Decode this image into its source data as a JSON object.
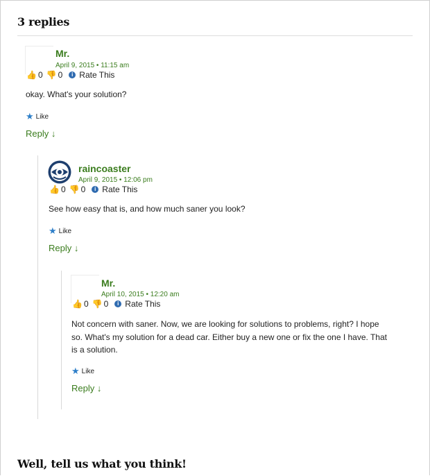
{
  "comments_heading": "3 replies",
  "footer_heading": "Well, tell us what you think!",
  "icons": {
    "thumb_up": "thumb-up-icon",
    "thumb_down": "thumb-down-icon",
    "info": "info-icon",
    "star": "star-icon",
    "avatar_logo": "raincoaster-logo-icon"
  },
  "colors": {
    "link_green": "#3a7c1d",
    "info_blue": "#2f6bb0",
    "star_blue": "#2e7fc9"
  },
  "comments": [
    {
      "author": "Mr.",
      "date": "April 9, 2015 • 11:15 am",
      "thumbs_up": "0",
      "thumbs_down": "0",
      "rate_label": "Rate This",
      "text": "okay. What's your solution?",
      "like_label": "Like",
      "reply_label": "Reply ↓"
    },
    {
      "author": "raincoaster",
      "date": "April 9, 2015 • 12:06 pm",
      "thumbs_up": "0",
      "thumbs_down": "0",
      "rate_label": "Rate This",
      "text": "See how easy that is, and how much saner you look?",
      "like_label": "Like",
      "reply_label": "Reply ↓"
    },
    {
      "author": "Mr.",
      "date": "April 10, 2015 • 12:20 am",
      "thumbs_up": "0",
      "thumbs_down": "0",
      "rate_label": "Rate This",
      "text": "Not concern with saner. Now, we are looking for solutions to problems, right? I hope so. What's my solution for a dead car. Either buy a new one or fix the one I have. That is a solution.",
      "like_label": "Like",
      "reply_label": "Reply ↓"
    }
  ]
}
